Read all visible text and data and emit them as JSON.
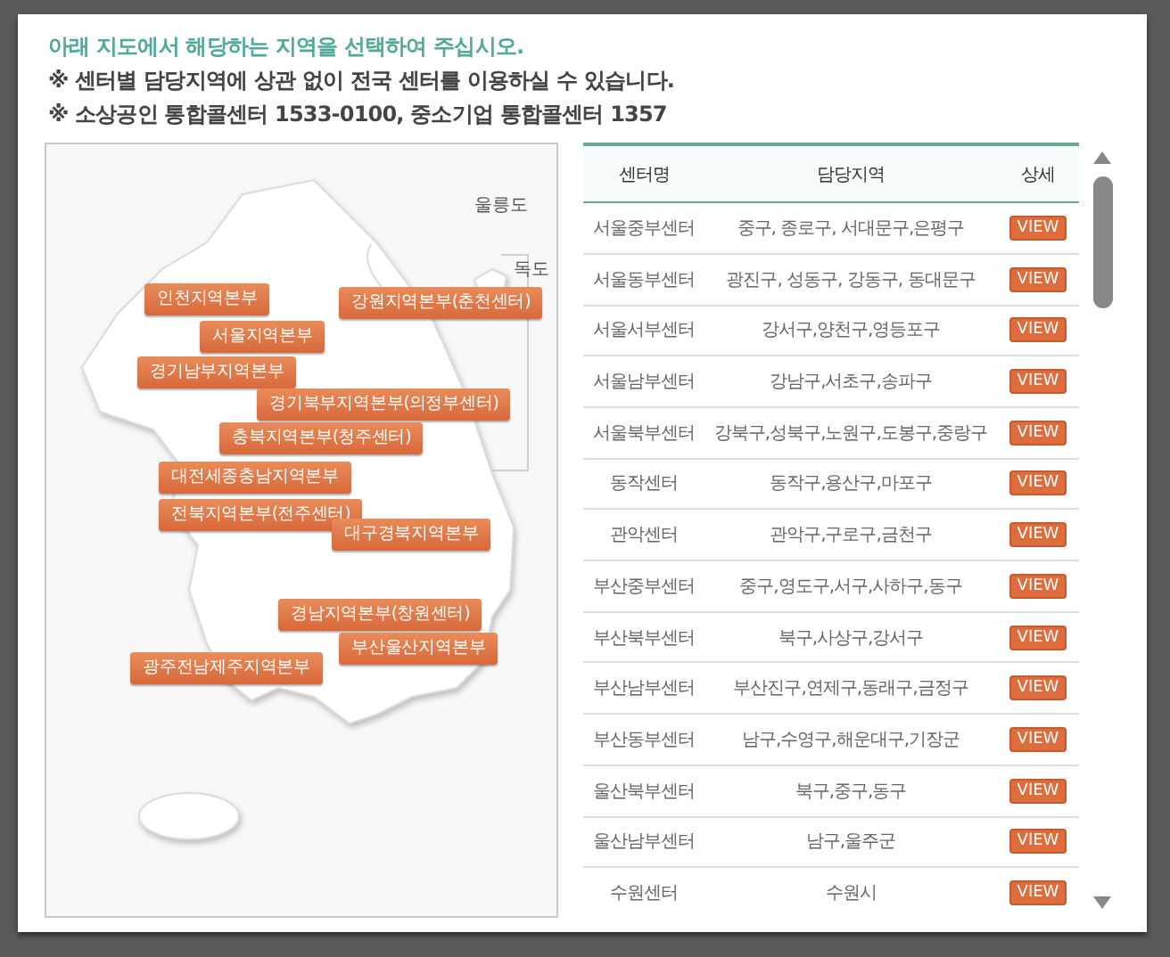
{
  "instructions": [
    {
      "kind": "lead",
      "text": "아래 지도에서 해당하는 지역을 선택하여 주십시오."
    },
    {
      "kind": "note",
      "text": "※ 센터별 담당지역에 상관 없이 전국 센터를 이용하실 수 있습니다."
    },
    {
      "kind": "note",
      "text": "※ 소상공인 통합콜센터 1533-0100, 중소기업 통합콜센터 1357"
    }
  ],
  "map": {
    "islands": [
      "울릉도",
      "독도"
    ],
    "regions": [
      "인천지역본부",
      "강원지역본부(춘천센터)",
      "서울지역본부",
      "경기남부지역본부",
      "경기북부지역본부(의정부센터)",
      "충북지역본부(청주센터)",
      "대전세종충남지역본부",
      "전북지역본부(전주센터)",
      "대구경북지역본부",
      "경남지역본부(창원센터)",
      "부산울산지역본부",
      "광주전남제주지역본부"
    ]
  },
  "table": {
    "columns": [
      "센터명",
      "담당지역",
      "상세"
    ],
    "rows": [
      {
        "center": "서울중부센터",
        "area": "중구, 종로구, 서대문구,은평구",
        "action": "VIEW"
      },
      {
        "center": "서울동부센터",
        "area": "광진구, 성동구, 강동구, 동대문구",
        "action": "VIEW"
      },
      {
        "center": "서울서부센터",
        "area": "강서구,양천구,영등포구",
        "action": "VIEW"
      },
      {
        "center": "서울남부센터",
        "area": "강남구,서초구,송파구",
        "action": "VIEW"
      },
      {
        "center": "서울북부센터",
        "area": "강북구,성북구,노원구,도봉구,중랑구",
        "action": "VIEW"
      },
      {
        "center": "동작센터",
        "area": "동작구,용산구,마포구",
        "action": "VIEW"
      },
      {
        "center": "관악센터",
        "area": "관악구,구로구,금천구",
        "action": "VIEW"
      },
      {
        "center": "부산중부센터",
        "area": "중구,영도구,서구,사하구,동구",
        "action": "VIEW"
      },
      {
        "center": "부산북부센터",
        "area": "북구,사상구,강서구",
        "action": "VIEW"
      },
      {
        "center": "부산남부센터",
        "area": "부산진구,연제구,동래구,금정구",
        "action": "VIEW"
      },
      {
        "center": "부산동부센터",
        "area": "남구,수영구,해운대구,기장군",
        "action": "VIEW"
      },
      {
        "center": "울산북부센터",
        "area": "북구,중구,동구",
        "action": "VIEW"
      },
      {
        "center": "울산남부센터",
        "area": "남구,울주군",
        "action": "VIEW"
      },
      {
        "center": "수원센터",
        "area": "수원시",
        "action": "VIEW"
      }
    ]
  }
}
